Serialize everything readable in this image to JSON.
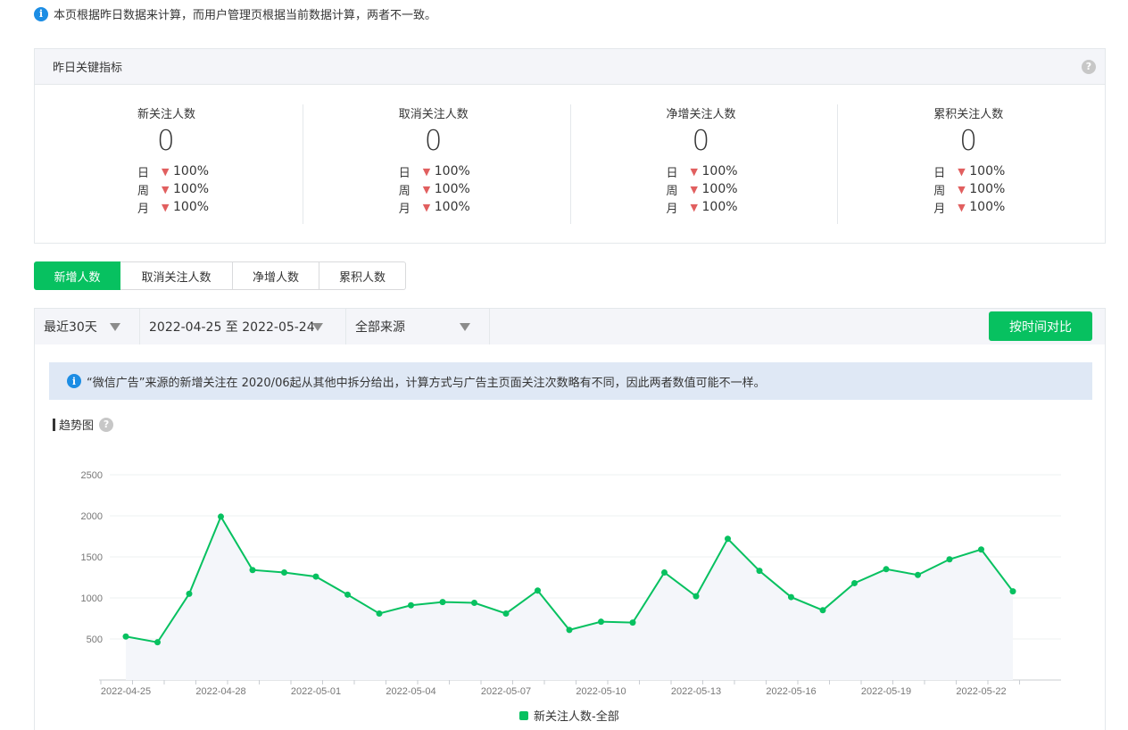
{
  "notice_top": "本页根据昨日数据来计算，而用户管理页根据当前数据计算，两者不一致。",
  "kpi": {
    "title": "昨日关键指标",
    "cards": [
      {
        "label": "新关注人数",
        "value": "0",
        "day_label": "日",
        "day": "100%",
        "week_label": "周",
        "week": "100%",
        "month_label": "月",
        "month": "100%"
      },
      {
        "label": "取消关注人数",
        "value": "0",
        "day_label": "日",
        "day": "100%",
        "week_label": "周",
        "week": "100%",
        "month_label": "月",
        "month": "100%"
      },
      {
        "label": "净增关注人数",
        "value": "0",
        "day_label": "日",
        "day": "100%",
        "week_label": "周",
        "week": "100%",
        "month_label": "月",
        "month": "100%"
      },
      {
        "label": "累积关注人数",
        "value": "0",
        "day_label": "日",
        "day": "100%",
        "week_label": "周",
        "week": "100%",
        "month_label": "月",
        "month": "100%"
      }
    ]
  },
  "tabs": [
    "新增人数",
    "取消关注人数",
    "净增人数",
    "累积人数"
  ],
  "filters": {
    "range": "最近30天",
    "dates": "2022-04-25 至 2022-05-24",
    "source": "全部来源",
    "compare_button": "按时间对比"
  },
  "notice_blue": "“微信广告”来源的新增关注在 2020/06起从其他中拆分给出，计算方式与广告主页面关注次数略有不同，因此两者数值可能不一样。",
  "trend_title": "趋势图",
  "colors": {
    "accent": "#07c160",
    "down_arrow": "#e15f5f",
    "info": "#1c8de4"
  },
  "chart_data": {
    "type": "line",
    "title": "",
    "xlabel": "",
    "ylabel": "",
    "ylim": [
      0,
      2500
    ],
    "yticks": [
      500,
      1000,
      1500,
      2000,
      2500
    ],
    "x": [
      "2022-04-25",
      "2022-04-26",
      "2022-04-27",
      "2022-04-28",
      "2022-04-29",
      "2022-04-30",
      "2022-05-01",
      "2022-05-02",
      "2022-05-03",
      "2022-05-04",
      "2022-05-05",
      "2022-05-06",
      "2022-05-07",
      "2022-05-08",
      "2022-05-09",
      "2022-05-10",
      "2022-05-11",
      "2022-05-12",
      "2022-05-13",
      "2022-05-14",
      "2022-05-15",
      "2022-05-16",
      "2022-05-17",
      "2022-05-18",
      "2022-05-19",
      "2022-05-20",
      "2022-05-21",
      "2022-05-22",
      "2022-05-23",
      "2022-05-24"
    ],
    "xtick_labels": [
      "2022-04-25",
      "2022-04-28",
      "2022-05-01",
      "2022-05-04",
      "2022-05-07",
      "2022-05-10",
      "2022-05-13",
      "2022-05-16",
      "2022-05-19",
      "2022-05-22"
    ],
    "series": [
      {
        "name": "新关注人数-全部",
        "values": [
          530,
          460,
          1050,
          1990,
          1340,
          1310,
          1260,
          1040,
          810,
          910,
          950,
          940,
          810,
          1090,
          610,
          710,
          700,
          1310,
          1020,
          1720,
          1330,
          1010,
          850,
          1180,
          1350,
          1280,
          1470,
          1590,
          1080
        ]
      }
    ],
    "grid": true,
    "legend_position": "bottom"
  }
}
